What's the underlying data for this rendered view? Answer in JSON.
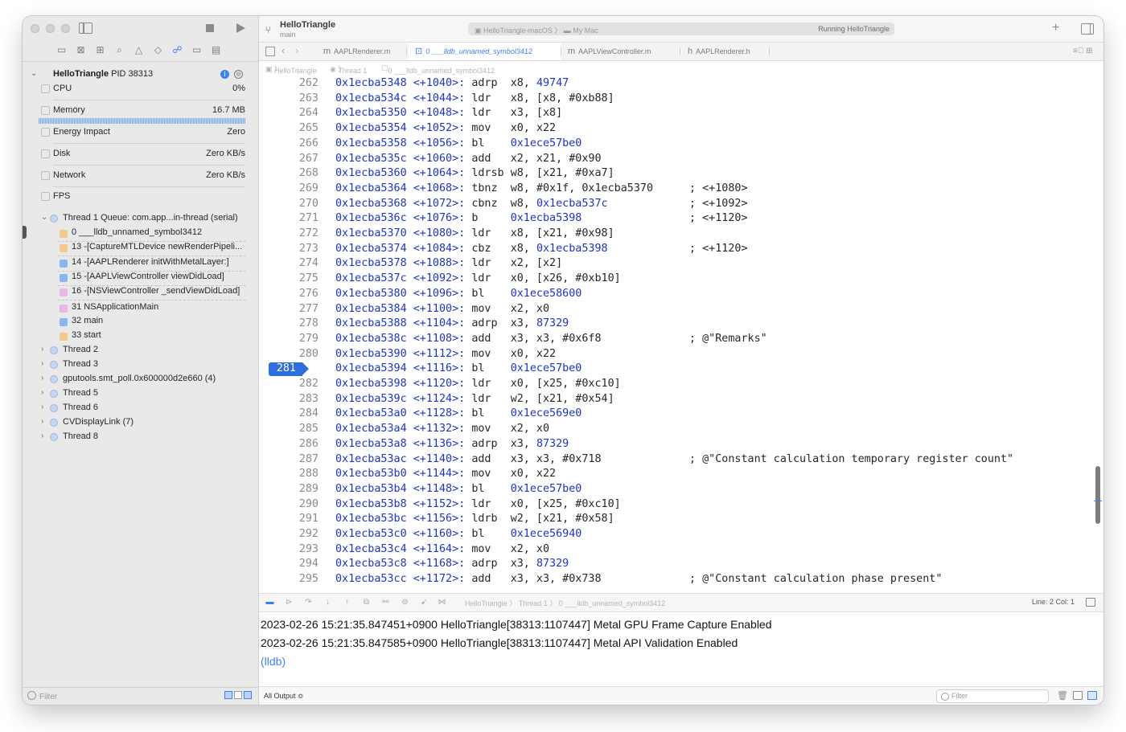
{
  "toolbar": {
    "project": "HelloTriangle",
    "branch": "main",
    "scheme": "HelloTriangle-macOS",
    "destination": "My Mac",
    "status": "Running HelloTriangle",
    "icons": [
      "branch-icon",
      "stop-icon",
      "run-icon",
      "add-icon",
      "inspector-toggle-icon"
    ]
  },
  "sidebar": {
    "process_name": "HelloTriangle",
    "process_pid": "PID 38313",
    "gauges": [
      {
        "label": "CPU",
        "value": "0%"
      },
      {
        "label": "Memory",
        "value": "16.7 MB"
      },
      {
        "label": "Energy Impact",
        "value": "Zero"
      },
      {
        "label": "Disk",
        "value": "Zero KB/s"
      },
      {
        "label": "Network",
        "value": "Zero KB/s"
      },
      {
        "label": "FPS",
        "value": ""
      }
    ],
    "thread1_label": "Thread 1 Queue: com.app...in-thread (serial)",
    "frames": [
      {
        "label": "0 ___lldb_unnamed_symbol3412",
        "color": "#f3c98b"
      },
      {
        "label": "13 -[CaptureMTLDevice newRenderPipeli...",
        "color": "#f3c98b"
      },
      {
        "label": "14 -[AAPLRenderer initWithMetalLayer:]",
        "color": "#8cb4f0"
      },
      {
        "label": "15 -[AAPLViewController viewDidLoad]",
        "color": "#8cb4f0"
      },
      {
        "label": "16 -[NSViewController _sendViewDidLoad]",
        "color": "#e9b8e8"
      },
      {
        "label": "31 NSApplicationMain",
        "color": "#e9b8e8"
      },
      {
        "label": "32 main",
        "color": "#8cb4f0"
      },
      {
        "label": "33 start",
        "color": "#f3c98b"
      }
    ],
    "threads": [
      "Thread 2",
      "Thread 3",
      "gputools.smt_poll.0x600000d2e660 (4)",
      "Thread 5",
      "Thread 6",
      "CVDisplayLink (7)",
      "Thread 8"
    ],
    "filter_placeholder": "Filter"
  },
  "tabs": [
    {
      "prefix": "m",
      "label": "AAPLRenderer.m",
      "active": false
    },
    {
      "prefix": "",
      "label": "0 ___lldb_unnamed_symbol3412",
      "active": true
    },
    {
      "prefix": "m",
      "label": "AAPLViewController.m",
      "active": false
    },
    {
      "prefix": "h",
      "label": "AAPLRenderer.h",
      "active": false
    }
  ],
  "jumpbar": {
    "parts": [
      "HelloTriangle",
      "Thread 1",
      "0 ___lldb_unnamed_symbol3412"
    ]
  },
  "disassembly": {
    "current_line": 281,
    "lines": [
      {
        "n": 262,
        "addr": "0x1ecba5348",
        "off": "<+1040>:",
        "op": "adrp",
        "args": "x8, ",
        "tgt": "49747",
        "cmt": ""
      },
      {
        "n": 263,
        "addr": "0x1ecba534c",
        "off": "<+1044>:",
        "op": "ldr",
        "args": "x8, [x8, #0xb88]",
        "tgt": "",
        "cmt": ""
      },
      {
        "n": 264,
        "addr": "0x1ecba5350",
        "off": "<+1048>:",
        "op": "ldr",
        "args": "x3, [x8]",
        "tgt": "",
        "cmt": ""
      },
      {
        "n": 265,
        "addr": "0x1ecba5354",
        "off": "<+1052>:",
        "op": "mov",
        "args": "x0, x22",
        "tgt": "",
        "cmt": ""
      },
      {
        "n": 266,
        "addr": "0x1ecba5358",
        "off": "<+1056>:",
        "op": "bl",
        "args": "",
        "tgt": "0x1ece57be0",
        "cmt": ""
      },
      {
        "n": 267,
        "addr": "0x1ecba535c",
        "off": "<+1060>:",
        "op": "add",
        "args": "x2, x21, #0x90",
        "tgt": "",
        "cmt": ""
      },
      {
        "n": 268,
        "addr": "0x1ecba5360",
        "off": "<+1064>:",
        "op": "ldrsb",
        "args": "w8, [x21, #0xa7]",
        "tgt": "",
        "cmt": ""
      },
      {
        "n": 269,
        "addr": "0x1ecba5364",
        "off": "<+1068>:",
        "op": "tbnz",
        "args": "w8, #0x1f, 0x1ecba5370",
        "tgt": "",
        "cmt": "; <+1080>"
      },
      {
        "n": 270,
        "addr": "0x1ecba5368",
        "off": "<+1072>:",
        "op": "cbnz",
        "args": "w8, ",
        "tgt": "0x1ecba537c",
        "cmt": "; <+1092>"
      },
      {
        "n": 271,
        "addr": "0x1ecba536c",
        "off": "<+1076>:",
        "op": "b",
        "args": "",
        "tgt": "0x1ecba5398",
        "cmt": "; <+1120>"
      },
      {
        "n": 272,
        "addr": "0x1ecba5370",
        "off": "<+1080>:",
        "op": "ldr",
        "args": "x8, [x21, #0x98]",
        "tgt": "",
        "cmt": ""
      },
      {
        "n": 273,
        "addr": "0x1ecba5374",
        "off": "<+1084>:",
        "op": "cbz",
        "args": "x8, ",
        "tgt": "0x1ecba5398",
        "cmt": "; <+1120>"
      },
      {
        "n": 274,
        "addr": "0x1ecba5378",
        "off": "<+1088>:",
        "op": "ldr",
        "args": "x2, [x2]",
        "tgt": "",
        "cmt": ""
      },
      {
        "n": 275,
        "addr": "0x1ecba537c",
        "off": "<+1092>:",
        "op": "ldr",
        "args": "x0, [x26, #0xb10]",
        "tgt": "",
        "cmt": ""
      },
      {
        "n": 276,
        "addr": "0x1ecba5380",
        "off": "<+1096>:",
        "op": "bl",
        "args": "",
        "tgt": "0x1ece58600",
        "cmt": ""
      },
      {
        "n": 277,
        "addr": "0x1ecba5384",
        "off": "<+1100>:",
        "op": "mov",
        "args": "x2, x0",
        "tgt": "",
        "cmt": ""
      },
      {
        "n": 278,
        "addr": "0x1ecba5388",
        "off": "<+1104>:",
        "op": "adrp",
        "args": "x3, ",
        "tgt": "87329",
        "cmt": ""
      },
      {
        "n": 279,
        "addr": "0x1ecba538c",
        "off": "<+1108>:",
        "op": "add",
        "args": "x3, x3, #0x6f8",
        "tgt": "",
        "cmt": "; @\"Remarks\""
      },
      {
        "n": 280,
        "addr": "0x1ecba5390",
        "off": "<+1112>:",
        "op": "mov",
        "args": "x0, x22",
        "tgt": "",
        "cmt": ""
      },
      {
        "n": 281,
        "addr": "0x1ecba5394",
        "off": "<+1116>:",
        "op": "bl",
        "args": "",
        "tgt": "0x1ece57be0",
        "cmt": ""
      },
      {
        "n": 282,
        "addr": "0x1ecba5398",
        "off": "<+1120>:",
        "op": "ldr",
        "args": "x0, [x25, #0xc10]",
        "tgt": "",
        "cmt": ""
      },
      {
        "n": 283,
        "addr": "0x1ecba539c",
        "off": "<+1124>:",
        "op": "ldr",
        "args": "w2, [x21, #0x54]",
        "tgt": "",
        "cmt": ""
      },
      {
        "n": 284,
        "addr": "0x1ecba53a0",
        "off": "<+1128>:",
        "op": "bl",
        "args": "",
        "tgt": "0x1ece569e0",
        "cmt": ""
      },
      {
        "n": 285,
        "addr": "0x1ecba53a4",
        "off": "<+1132>:",
        "op": "mov",
        "args": "x2, x0",
        "tgt": "",
        "cmt": ""
      },
      {
        "n": 286,
        "addr": "0x1ecba53a8",
        "off": "<+1136>:",
        "op": "adrp",
        "args": "x3, ",
        "tgt": "87329",
        "cmt": ""
      },
      {
        "n": 287,
        "addr": "0x1ecba53ac",
        "off": "<+1140>:",
        "op": "add",
        "args": "x3, x3, #0x718",
        "tgt": "",
        "cmt": "; @\"Constant calculation temporary register count\""
      },
      {
        "n": 288,
        "addr": "0x1ecba53b0",
        "off": "<+1144>:",
        "op": "mov",
        "args": "x0, x22",
        "tgt": "",
        "cmt": ""
      },
      {
        "n": 289,
        "addr": "0x1ecba53b4",
        "off": "<+1148>:",
        "op": "bl",
        "args": "",
        "tgt": "0x1ece57be0",
        "cmt": ""
      },
      {
        "n": 290,
        "addr": "0x1ecba53b8",
        "off": "<+1152>:",
        "op": "ldr",
        "args": "x0, [x25, #0xc10]",
        "tgt": "",
        "cmt": ""
      },
      {
        "n": 291,
        "addr": "0x1ecba53bc",
        "off": "<+1156>:",
        "op": "ldrb",
        "args": "w2, [x21, #0x58]",
        "tgt": "",
        "cmt": ""
      },
      {
        "n": 292,
        "addr": "0x1ecba53c0",
        "off": "<+1160>:",
        "op": "bl",
        "args": "",
        "tgt": "0x1ece56940",
        "cmt": ""
      },
      {
        "n": 293,
        "addr": "0x1ecba53c4",
        "off": "<+1164>:",
        "op": "mov",
        "args": "x2, x0",
        "tgt": "",
        "cmt": ""
      },
      {
        "n": 294,
        "addr": "0x1ecba53c8",
        "off": "<+1168>:",
        "op": "adrp",
        "args": "x3, ",
        "tgt": "87329",
        "cmt": ""
      },
      {
        "n": 295,
        "addr": "0x1ecba53cc",
        "off": "<+1172>:",
        "op": "add",
        "args": "x3, x3, #0x738",
        "tgt": "",
        "cmt": "; @\"Constant calculation phase present\""
      }
    ]
  },
  "debugbar": {
    "crumbs": "HelloTriangle 〉 Thread 1 〉 0 ___lldb_unnamed_symbol3412",
    "position": "Line: 2  Col: 1"
  },
  "console": {
    "lines": [
      "2023-02-26 15:21:35.847451+0900 HelloTriangle[38313:1107447] Metal GPU Frame Capture Enabled",
      "2023-02-26 15:21:35.847585+0900 HelloTriangle[38313:1107447] Metal API Validation Enabled"
    ],
    "prompt": "(lldb)",
    "output_selector": "All Output ≎",
    "filter_placeholder": "Filter"
  },
  "colors": {
    "accent": "#2f6ee0",
    "address": "#1c34c9"
  }
}
